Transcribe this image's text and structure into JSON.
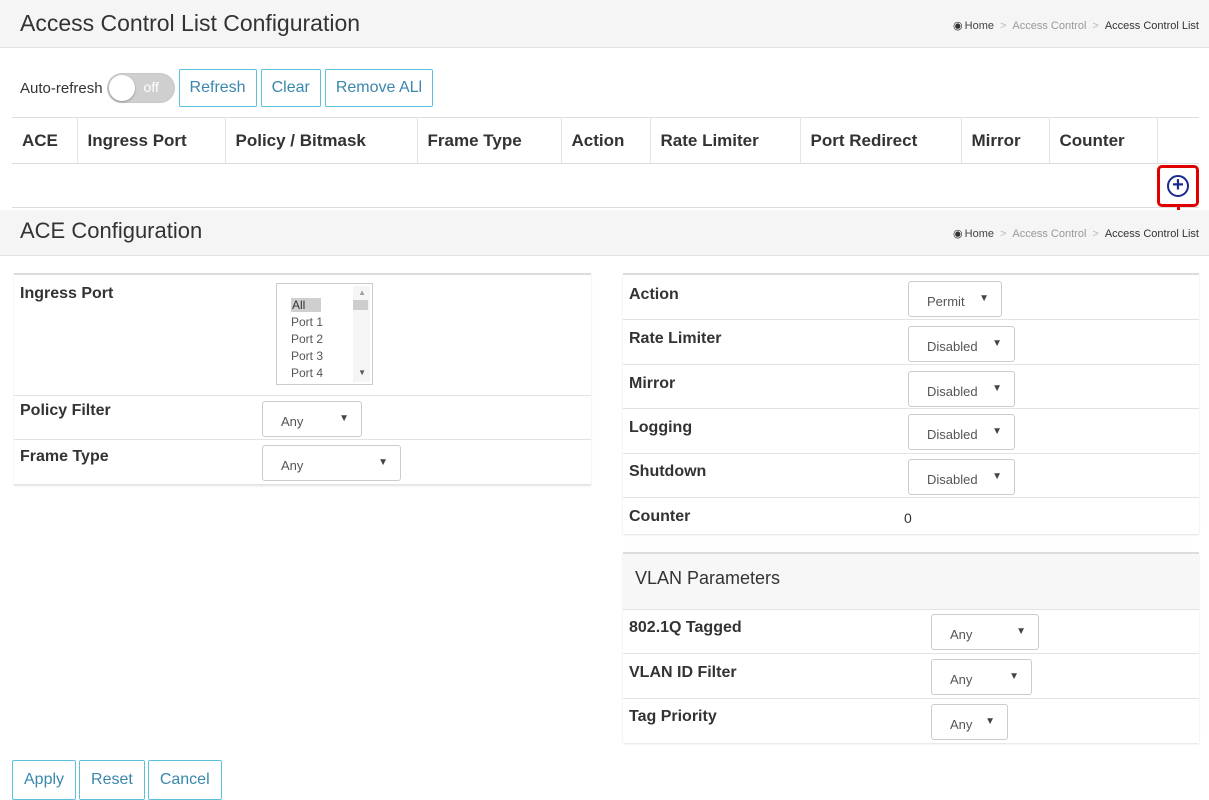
{
  "header": {
    "title": "Access Control List Configuration",
    "breadcrumb": {
      "home": "Home",
      "section": "Access Control",
      "current": "Access Control List"
    }
  },
  "toolbar": {
    "auto_refresh_label": "Auto-refresh",
    "toggle_state": "off",
    "refresh": "Refresh",
    "clear": "Clear",
    "remove_all": "Remove ALl"
  },
  "acl_table": {
    "columns": [
      "ACE",
      "Ingress Port",
      "Policy / Bitmask",
      "Frame Type",
      "Action",
      "Rate Limiter",
      "Port Redirect",
      "Mirror",
      "Counter",
      ""
    ],
    "add_icon": "plus-circle-icon"
  },
  "ace": {
    "title": "ACE Configuration",
    "breadcrumb": {
      "home": "Home",
      "section": "Access Control",
      "current": "Access Control List"
    },
    "ingress_port": {
      "label": "Ingress Port",
      "options": [
        "All",
        "Port 1",
        "Port 2",
        "Port 3",
        "Port 4"
      ],
      "selected": "All"
    },
    "policy_filter": {
      "label": "Policy Filter",
      "value": "Any"
    },
    "frame_type": {
      "label": "Frame Type",
      "value": "Any"
    },
    "action": {
      "label": "Action",
      "value": "Permit"
    },
    "rate_limiter": {
      "label": "Rate Limiter",
      "value": "Disabled"
    },
    "mirror": {
      "label": "Mirror",
      "value": "Disabled"
    },
    "logging": {
      "label": "Logging",
      "value": "Disabled"
    },
    "shutdown": {
      "label": "Shutdown",
      "value": "Disabled"
    },
    "counter": {
      "label": "Counter",
      "value": "0"
    }
  },
  "vlan": {
    "title": "VLAN Parameters",
    "tagged": {
      "label": "802.1Q Tagged",
      "value": "Any"
    },
    "vlan_id_filter": {
      "label": "VLAN ID Filter",
      "value": "Any"
    },
    "tag_priority": {
      "label": "Tag Priority",
      "value": "Any"
    }
  },
  "footer": {
    "apply": "Apply",
    "reset": "Reset",
    "cancel": "Cancel"
  },
  "colors": {
    "accent": "#5bc0de",
    "button_text": "#3a87ad",
    "highlight": "#e00000",
    "add_icon": "#1a2a8c"
  }
}
